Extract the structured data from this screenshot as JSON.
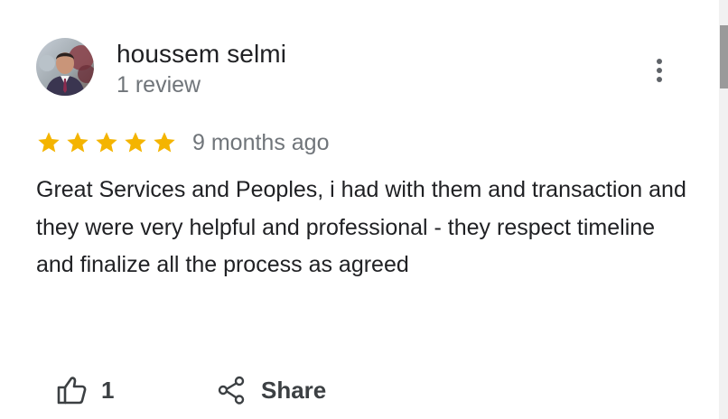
{
  "review": {
    "reviewer_name": "houssem selmi",
    "review_count": "1 review",
    "rating": 5,
    "date": "9 months ago",
    "text": "Great Services and Peoples, i had with them and transaction and they were very helpful and professional - they respect timeline and finalize all the process as agreed",
    "star_color": "#f4b400"
  },
  "actions": {
    "like_count": "1",
    "share_label": "Share",
    "like_icon": "thumb-up-icon",
    "share_icon": "share-icon",
    "menu_icon": "more-vert-icon"
  },
  "colors": {
    "primary_text": "#202124",
    "secondary_text": "#70757a",
    "icon": "#3c4043"
  }
}
